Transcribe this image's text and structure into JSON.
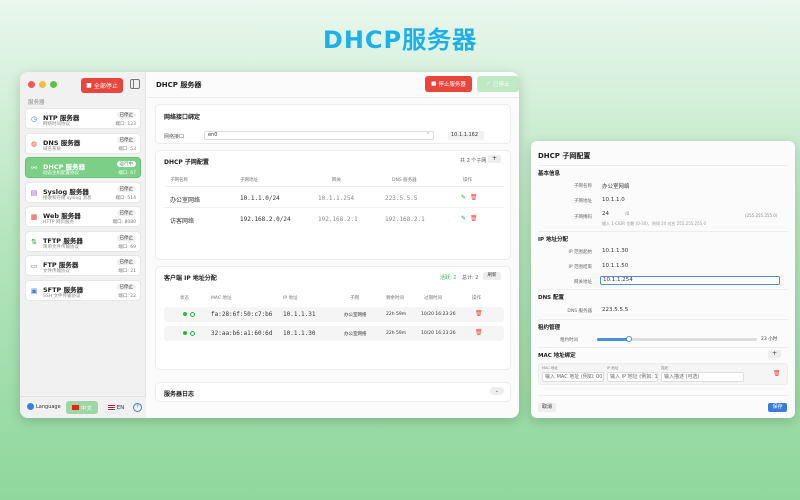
{
  "hero_title": "DHCP服务器",
  "main": {
    "stop_all_label": "全部停止",
    "sidebar_section": "服务器",
    "services": [
      {
        "name": "NTP 服务器",
        "desc": "网络时间协议",
        "status": "已停止",
        "port": "端口: 123",
        "icon": "clock-icon",
        "color": "#3b7dd8"
      },
      {
        "name": "DNS 服务器",
        "desc": "域名系统",
        "status": "已停止",
        "port": "端口: 53",
        "icon": "globe-icon",
        "color": "#e8453c"
      },
      {
        "name": "DHCP 服务器",
        "desc": "动态主机配置协议",
        "status": "运行中",
        "port": "端口: 67",
        "icon": "network-icon",
        "color": "#ffffff"
      },
      {
        "name": "Syslog 服务器",
        "desc": "接收和存储 syslog 消息",
        "status": "已停止",
        "port": "端口: 514",
        "icon": "doc-icon",
        "color": "#8e5bd8"
      },
      {
        "name": "Web 服务器",
        "desc": "HTTP 网页服务",
        "status": "已停止",
        "port": "端口: 8080",
        "icon": "web-icon",
        "color": "#e8453c"
      },
      {
        "name": "TFTP 服务器",
        "desc": "简单文件传输协议",
        "status": "已停止",
        "port": "端口: 69",
        "icon": "transfer-icon",
        "color": "#2f9a45"
      },
      {
        "name": "FTP 服务器",
        "desc": "文件传输协议",
        "status": "已停止",
        "port": "端口: 21",
        "icon": "folder-icon",
        "color": "#8e5bd8"
      },
      {
        "name": "SFTP 服务器",
        "desc": "SSH 文件传输协议",
        "status": "已停止",
        "port": "端口: 22",
        "icon": "lock-icon",
        "color": "#3b7dd8"
      }
    ],
    "footer": {
      "language": "Language",
      "zh": "中文",
      "en": "EN",
      "help": "?"
    },
    "title": "DHCP 服务器",
    "btn_stop": "停止服务器",
    "btn_stopped": "已停止",
    "iface": {
      "header": "网络接口绑定",
      "label": "网络接口",
      "value": "en0",
      "ip": "10.1.1.162"
    },
    "subnet": {
      "header": "DHCP 子网配置",
      "count": "共 2 个子网",
      "add": "+",
      "columns": [
        "子网名称",
        "子网地址",
        "网关",
        "DNS 服务器",
        "操作"
      ],
      "rows": [
        {
          "name": "办公室网络",
          "addr": "10.1.1.0/24",
          "gw": "10.1.1.254",
          "dns": "223.5.5.5"
        },
        {
          "name": "访客网络",
          "addr": "192.168.2.0/24",
          "gw": "192.168.2.1",
          "dns": "192.168.2.1"
        }
      ]
    },
    "leases": {
      "header": "客户端 IP 地址分配",
      "active": "活跃: 2",
      "total": "总计: 2",
      "refresh": "刷新",
      "columns": [
        "状态",
        "MAC 地址",
        "IP 地址",
        "子网",
        "剩余时间",
        "过期时间",
        "操作"
      ],
      "rows": [
        {
          "mac": "fa:28:6f:50:c7:b6",
          "ip": "10.1.1.31",
          "subnet": "办公室网络",
          "remain": "22h 59m",
          "expire": "10/20 16:23:26"
        },
        {
          "mac": "32:aa:b6:a1:60:6d",
          "ip": "10.1.1.30",
          "subnet": "办公室网络",
          "remain": "22h 59m",
          "expire": "10/20 16:23:26"
        }
      ]
    },
    "log": {
      "header": "服务器日志",
      "toggle": "⌄"
    }
  },
  "side": {
    "title": "DHCP 子网配置",
    "basic": "基本信息",
    "subnet_name_label": "子网名称",
    "subnet_name": "办公室网络",
    "subnet_addr_label": "子网地址",
    "subnet_addr": "10.1.1.0",
    "mask_label": "子网掩码",
    "mask": "24",
    "mask_sep": "/0",
    "mask_full": "(255.255.255.0)",
    "mask_hint": "输入 1-CIDR 位数 (0-30)，例如 24 对应 255.255.255.0",
    "pool": "IP 地址分配",
    "start_label": "IP 范围起始",
    "start": "10.1.1.30",
    "end_label": "IP 范围结束",
    "end": "10.1.1.50",
    "gw_label": "网关地址",
    "gw": "10.1.1.254",
    "dns_sec": "DNS 配置",
    "dns_label": "DNS 服务器",
    "dns": "223.5.5.5",
    "lease_sec": "租约管理",
    "lease_label": "租约时间",
    "lease_value": "23 小时",
    "lease_fraction": 0.2,
    "mac_sec": "MAC 地址绑定",
    "mac_add": "+",
    "bind_labels": [
      "MAC 地址",
      "IP 地址",
      "描述"
    ],
    "bind_placeholders": [
      "输入 MAC 地址 (例如: 00:1",
      "输入 IP 地址 (例如: 192",
      "输入描述 (可选)"
    ],
    "cancel": "取消",
    "save": "保存"
  }
}
